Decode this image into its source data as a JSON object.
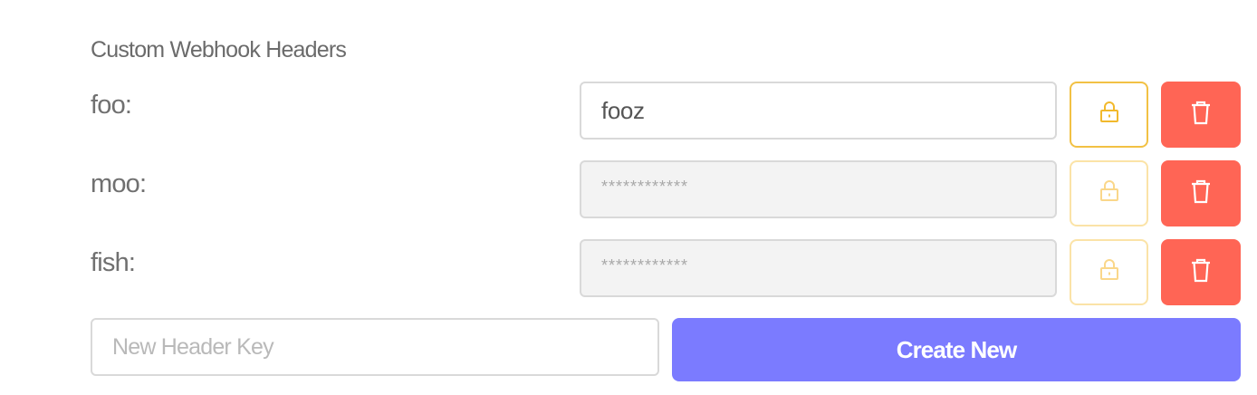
{
  "section": {
    "title": "Custom Webhook Headers"
  },
  "headers": [
    {
      "key": "foo:",
      "value": "fooz",
      "masked": false
    },
    {
      "key": "moo:",
      "value": "************",
      "masked": true
    },
    {
      "key": "fish:",
      "value": "************",
      "masked": true
    }
  ],
  "icons": {
    "lock": "lock-icon",
    "delete": "trash-icon"
  },
  "new_header": {
    "placeholder": "New Header Key",
    "value": "",
    "create_label": "Create New"
  },
  "colors": {
    "lock_border_active": "#f2c144",
    "lock_border_faded": "#fbe3a7",
    "delete_bg": "#ff6555",
    "create_bg": "#7b7bff"
  }
}
